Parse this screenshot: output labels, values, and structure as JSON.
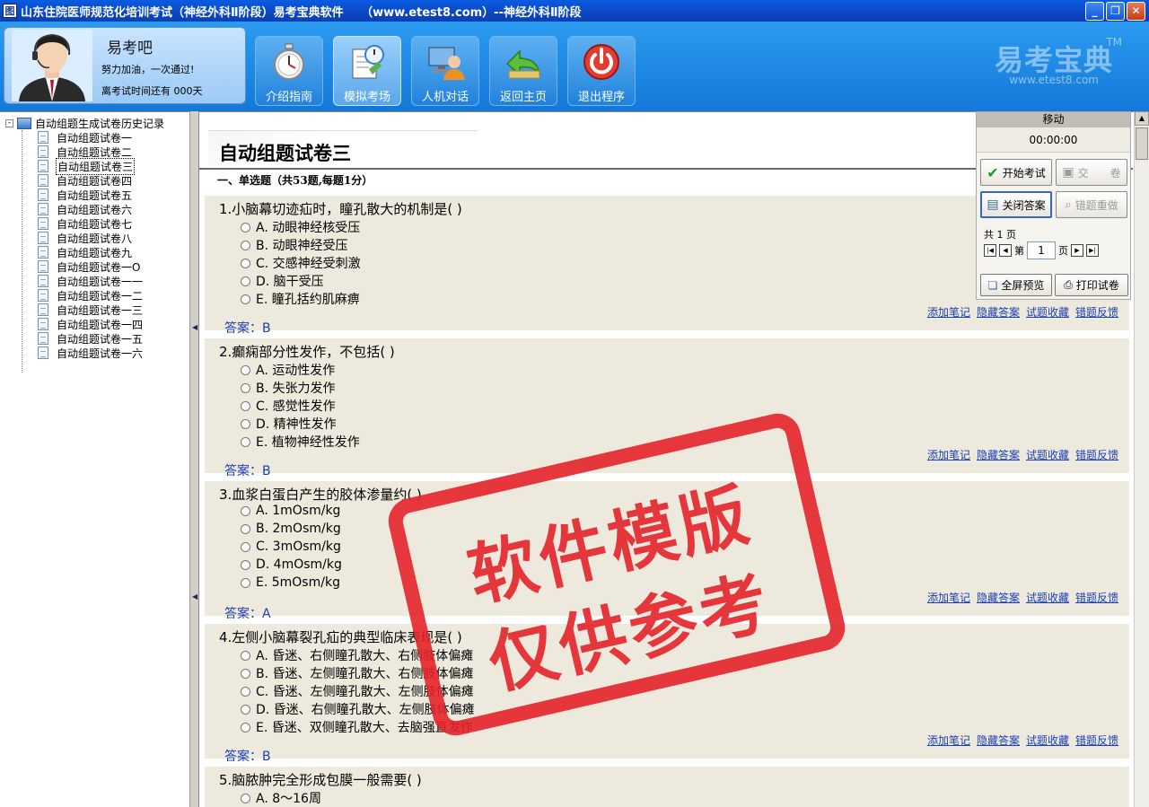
{
  "window": {
    "title": "山东住院医师规范化培训考试（神经外科Ⅱ阶段）易考宝典软件　　（www.etest8.com）--神经外科Ⅱ阶段",
    "app_icon_char": "图",
    "minimize": "_",
    "maximize": "❐",
    "close": "✕"
  },
  "profile": {
    "name": "易考吧",
    "motto": "努力加油，一次通过!",
    "countdown": "离考试时间还有 000天"
  },
  "nav": [
    {
      "label": "介绍指南",
      "icon": "stopwatch-icon"
    },
    {
      "label": "模拟考场",
      "icon": "exam-icon"
    },
    {
      "label": "人机对话",
      "icon": "computer-user-icon"
    },
    {
      "label": "返回主页",
      "icon": "back-arrow-icon"
    },
    {
      "label": "退出程序",
      "icon": "power-icon"
    }
  ],
  "brand": {
    "name": "易考宝典",
    "tm": "TM",
    "url": "www.etest8.com"
  },
  "tree": {
    "root": "自动组题生成试卷历史记录",
    "items": [
      "自动组题试卷一",
      "自动组题试卷二",
      "自动组题试卷三",
      "自动组题试卷四",
      "自动组题试卷五",
      "自动组题试卷六",
      "自动组题试卷七",
      "自动组题试卷八",
      "自动组题试卷九",
      "自动组题试卷一O",
      "自动组题试卷一一",
      "自动组题试卷一二",
      "自动组题试卷一三",
      "自动组题试卷一四",
      "自动组题试卷一五",
      "自动组题试卷一六"
    ],
    "selected_index": 2
  },
  "paper": {
    "title": "自动组题试卷三",
    "section": "一、单选题（共53题,每题1分）"
  },
  "question_links": [
    "添加笔记",
    "隐藏答案",
    "试题收藏",
    "错题反馈"
  ],
  "questions": [
    {
      "stem": "1.小脑幕切迹疝时，瞳孔散大的机制是( )",
      "options": [
        "A. 动眼神经核受压",
        "B. 动眼神经受压",
        "C. 交感神经受刺激",
        "D. 脑干受压",
        "E. 瞳孔括约肌麻痹"
      ],
      "answer": "答案：B"
    },
    {
      "stem": "2.癫痫部分性发作，不包括( )",
      "options": [
        "A. 运动性发作",
        "B. 失张力发作",
        "C. 感觉性发作",
        "D. 精神性发作",
        "E. 植物神经性发作"
      ],
      "answer": "答案：B"
    },
    {
      "stem": "3.血浆白蛋白产生的胶体渗量约( )",
      "options": [
        "A. 1mOsm/kg",
        "B. 2mOsm/kg",
        "C. 3mOsm/kg",
        "D. 4mOsm/kg",
        "E. 5mOsm/kg"
      ],
      "answer": "答案：A"
    },
    {
      "stem": "4.左侧小脑幕裂孔疝的典型临床表现是( )",
      "options": [
        "A. 昏迷、右侧瞳孔散大、右侧肢体偏瘫",
        "B. 昏迷、左侧瞳孔散大、右侧肢体偏瘫",
        "C. 昏迷、左侧瞳孔散大、左侧肢体偏瘫",
        "D. 昏迷、右侧瞳孔散大、左侧肢体偏瘫",
        "E. 昏迷、双侧瞳孔散大、去脑强直发作"
      ],
      "answer": "答案：B"
    },
    {
      "stem": "5.脑脓肿完全形成包膜一般需要( )",
      "options": [
        "A. 8～16周"
      ],
      "answer": ""
    }
  ],
  "panel": {
    "header": "移动",
    "timer": "00:00:00",
    "start_exam": "开始考试",
    "submit": "交　　卷",
    "close_answer": "关闭答案",
    "redo_wrong": "错题重做",
    "total_pages": "共 1 页",
    "page_prefix": "第",
    "page_value": "1",
    "page_suffix": "页",
    "fullscreen_preview": "全屏预览",
    "print_paper": "打印试卷"
  },
  "stamp": {
    "line1": "软件模版",
    "line2": "仅供参考"
  },
  "colors": {
    "accent": "#1478d8",
    "link": "#1a3fb6",
    "stamp": "#e4232a",
    "question_bg": "#ede9dc"
  }
}
